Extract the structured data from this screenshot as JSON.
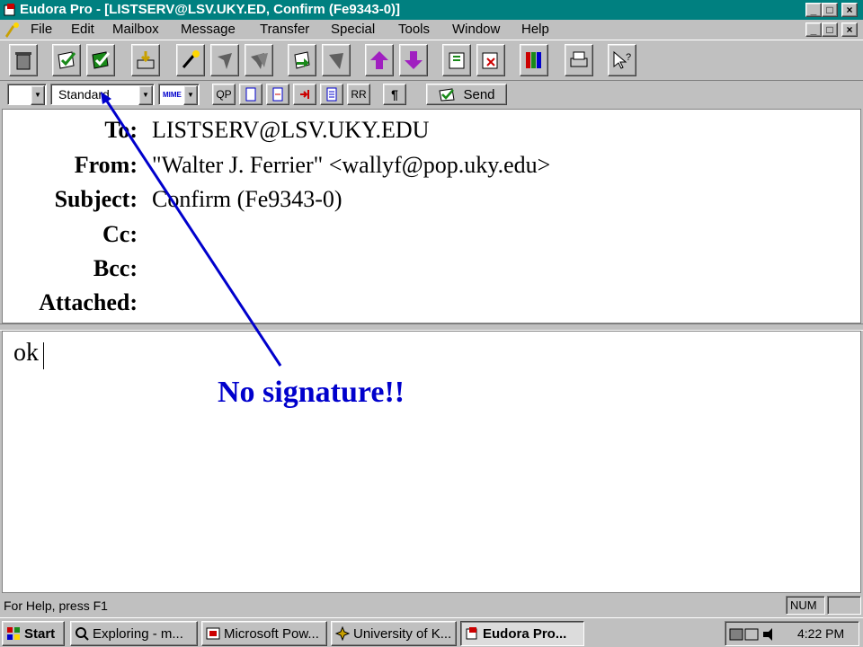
{
  "window": {
    "title": "Eudora Pro - [LISTSERV@LSV.UKY.ED, Confirm (Fe9343-0)]",
    "controls": {
      "minimize": "_",
      "maximize": "□",
      "close": "×"
    }
  },
  "menu": {
    "items": [
      {
        "label": "File"
      },
      {
        "label": "Edit"
      },
      {
        "label": "Mailbox"
      },
      {
        "label": "Message"
      },
      {
        "label": "Transfer"
      },
      {
        "label": "Special"
      },
      {
        "label": "Tools"
      },
      {
        "label": "Window"
      },
      {
        "label": "Help"
      }
    ]
  },
  "toolbar": {
    "icons": [
      "trash-icon",
      "check-mail-icon",
      "send-queued-icon",
      "attach-icon",
      "new-message-icon",
      "reply-icon",
      "reply-all-icon",
      "forward-icon",
      "redirect-icon",
      "previous-message-icon",
      "next-message-icon",
      "address-book-icon",
      "filters-icon",
      "palette-icon",
      "print-icon",
      "help-pointer-icon"
    ]
  },
  "format": {
    "font_size": "",
    "signature_select": "Standard",
    "encoding": "MIME",
    "qp": "QP",
    "rr": "RR",
    "paragraph": "¶",
    "send_label": "Send"
  },
  "header": {
    "to_label": "To:",
    "to_value": "LISTSERV@LSV.UKY.EDU",
    "from_label": "From:",
    "from_value": "\"Walter J. Ferrier\" <wallyf@pop.uky.edu>",
    "subject_label": "Subject:",
    "subject_value": "Confirm (Fe9343-0)",
    "cc_label": "Cc:",
    "bcc_label": "Bcc:",
    "attached_label": "Attached:"
  },
  "body": {
    "text": "ok"
  },
  "annotation": {
    "text": "No signature!!",
    "color": "#0000cc"
  },
  "status": {
    "help_text": "For Help, press F1",
    "num": "NUM"
  },
  "taskbar": {
    "start": "Start",
    "tasks": [
      {
        "label": "Exploring - m..."
      },
      {
        "label": "Microsoft Pow..."
      },
      {
        "label": "University of K..."
      },
      {
        "label": "Eudora Pro..."
      }
    ],
    "clock": "4:22 PM"
  },
  "colors": {
    "titlebar": "#008080",
    "face": "#c0c0c0"
  }
}
